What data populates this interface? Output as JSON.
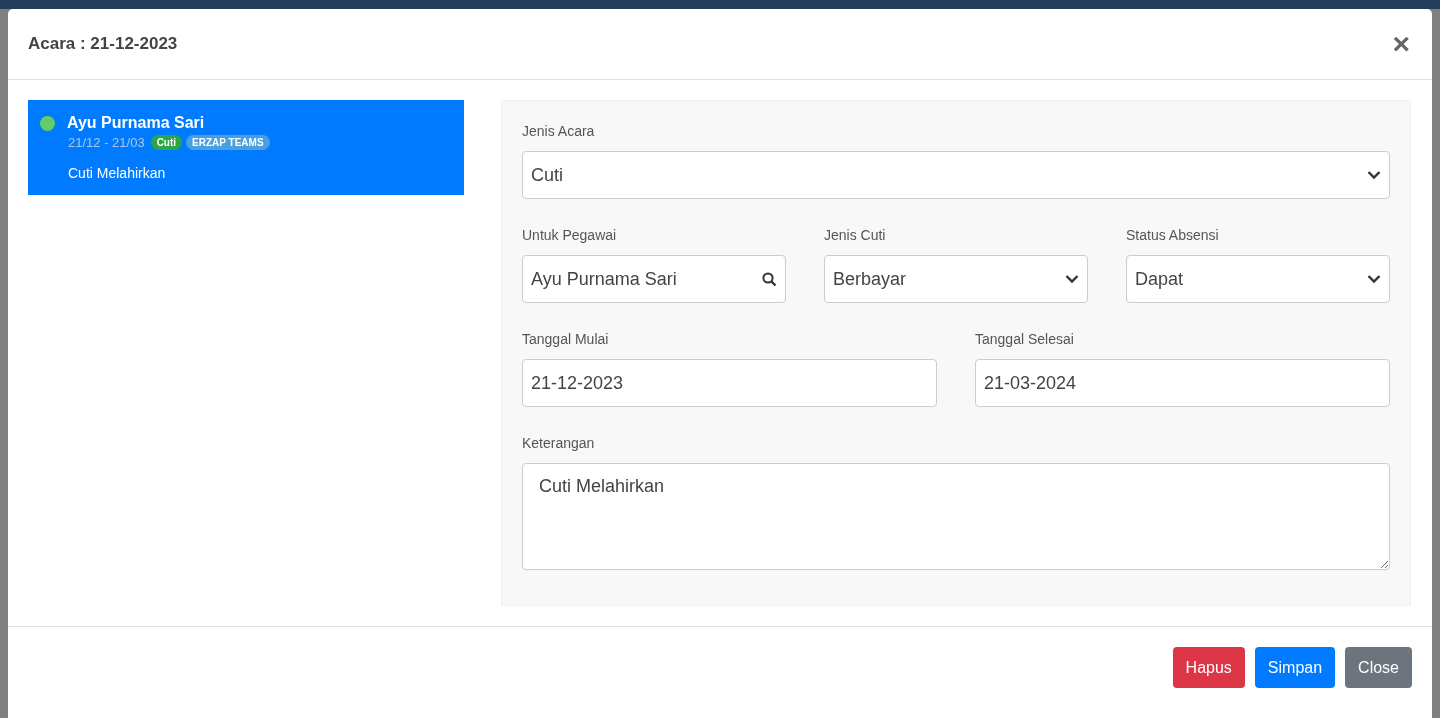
{
  "modal": {
    "title": "Acara : 21-12-2023",
    "close": "×"
  },
  "events": [
    {
      "name": "Ayu Purnama Sari",
      "dates": "21/12 - 21/03",
      "color": "#66cc66",
      "selected": true,
      "note": "Cuti Melahirkan",
      "tags": [
        {
          "label": "Cuti",
          "color": "#28a745"
        },
        {
          "label": "ERZAP TEAMS",
          "color": "#4a9fe0"
        }
      ]
    }
  ],
  "form": {
    "rows": [
      {
        "fields": [
          {
            "label": "Jenis Acara",
            "kind": "select",
            "value": "Cuti"
          }
        ]
      },
      {
        "fields": [
          {
            "label": "Untuk Pegawai",
            "kind": "search",
            "value": "Ayu Purnama Sari"
          },
          {
            "label": "Jenis Cuti",
            "kind": "select",
            "value": "Berbayar"
          },
          {
            "label": "Status Absensi",
            "kind": "select",
            "value": "Dapat"
          }
        ]
      },
      {
        "fields": [
          {
            "label": "Tanggal Mulai",
            "kind": "text",
            "value": "21-12-2023"
          },
          {
            "label": "Tanggal Selesai",
            "kind": "text",
            "value": "21-03-2024"
          }
        ]
      },
      {
        "fields": [
          {
            "label": "Keterangan",
            "kind": "textarea",
            "value": "Cuti Melahirkan"
          }
        ]
      }
    ]
  },
  "buttons": [
    {
      "label": "Hapus",
      "kind": "danger"
    },
    {
      "label": "Simpan",
      "kind": "primary"
    },
    {
      "label": "Close",
      "kind": "secondary"
    }
  ]
}
